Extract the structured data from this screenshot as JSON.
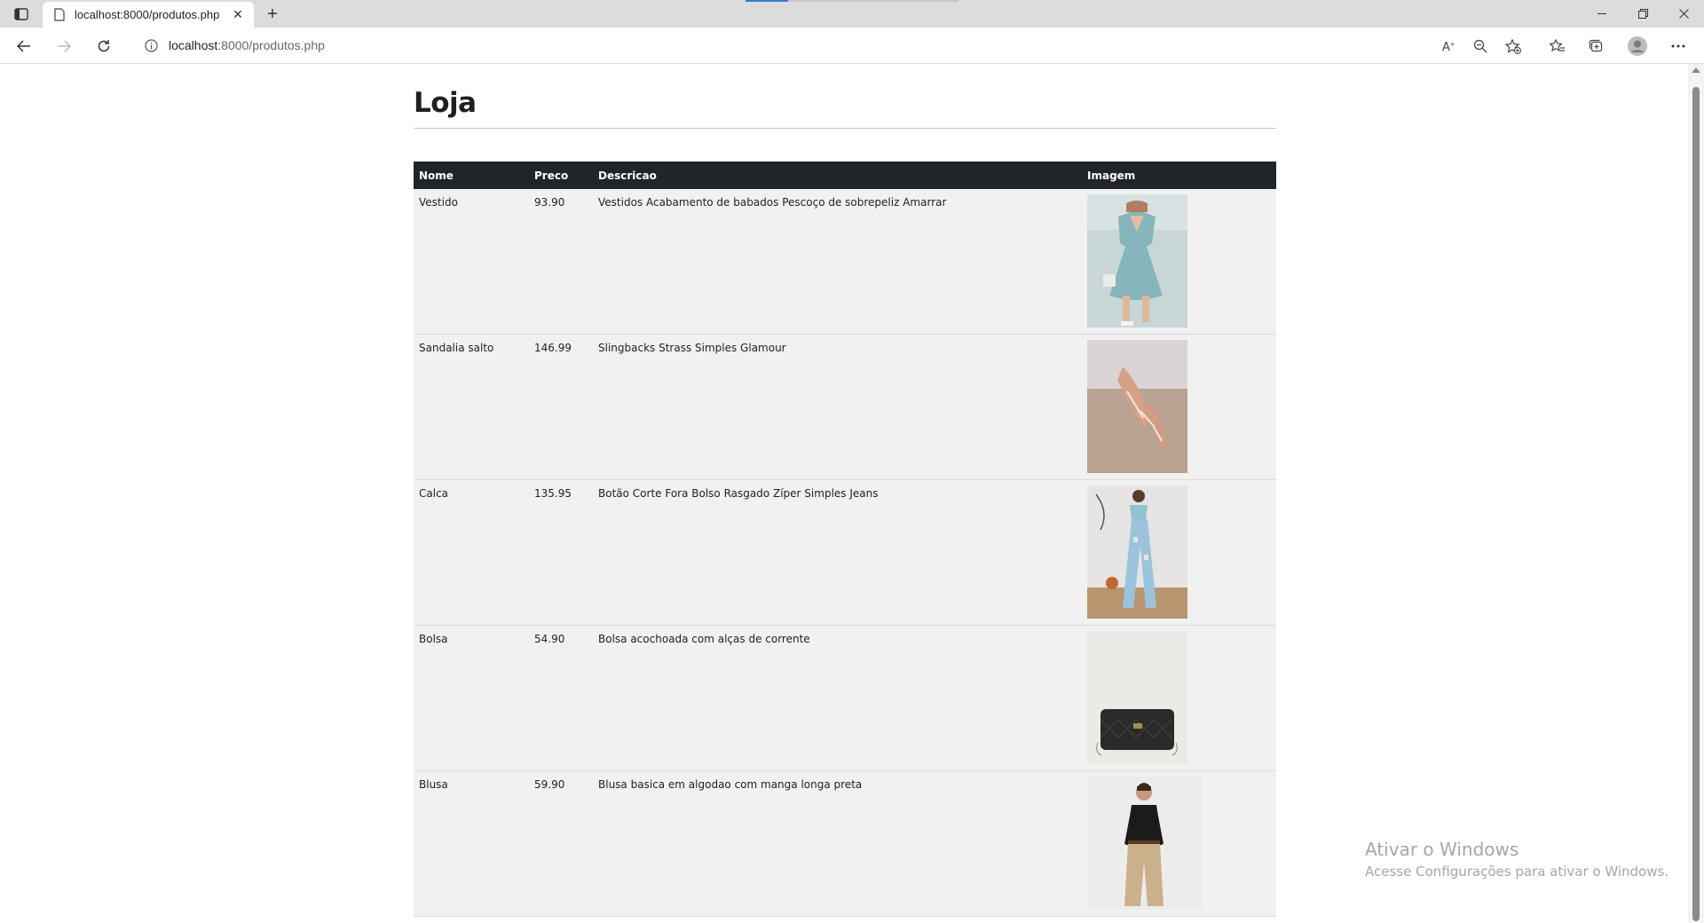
{
  "browser": {
    "tab_title": "localhost:8000/produtos.php",
    "url_host": "localhost",
    "url_rest": ":8000/produtos.php",
    "new_tab_label": "+",
    "close_label": "✕"
  },
  "page": {
    "heading": "Loja",
    "columns": [
      "Nome",
      "Preco",
      "Descricao",
      "Imagem"
    ],
    "rows": [
      {
        "nome": "Vestido",
        "preco": "93.90",
        "descricao": "Vestidos Acabamento de babados Pescoço de sobrepeliz Amarrar",
        "image": "dress-photo"
      },
      {
        "nome": "Sandalia salto",
        "preco": "146.99",
        "descricao": "Slingbacks Strass Simples Glamour",
        "image": "sandal-photo"
      },
      {
        "nome": "Calca",
        "preco": "135.95",
        "descricao": "Botão Corte Fora Bolso Rasgado Zíper Simples Jeans",
        "image": "jeans-photo"
      },
      {
        "nome": "Bolsa",
        "preco": "54.90",
        "descricao": "Bolsa acochoada com alças de corrente",
        "image": "bag-photo"
      },
      {
        "nome": "Blusa",
        "preco": "59.90",
        "descricao": "Blusa basica em algodao com manga longa preta",
        "image": "blouse-photo"
      }
    ]
  },
  "watermark": {
    "line1": "Ativar o Windows",
    "line2": "Acesse Configurações para ativar o Windows."
  },
  "colors": {
    "header_bg": "#212529",
    "row_bg": "#f1f1f1",
    "tabstrip_bg": "#dcdcdc"
  }
}
